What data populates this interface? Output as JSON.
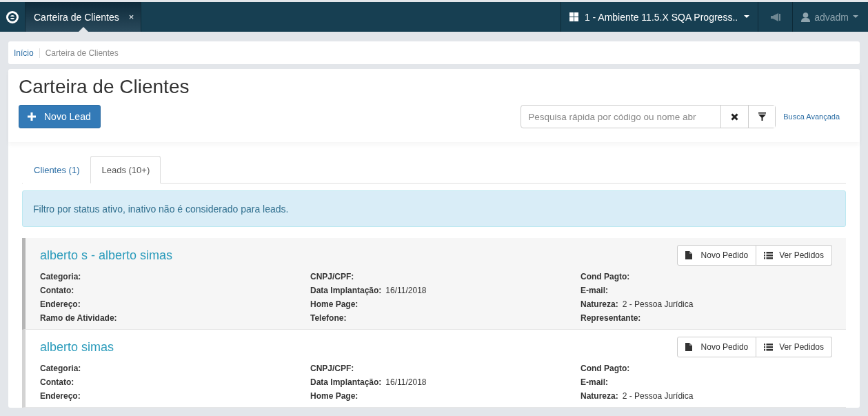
{
  "topbar": {
    "tab": {
      "label": "Carteira de Clientes",
      "close": "×",
      "selected": true
    },
    "environment": "1 - Ambiente 11.5.X SQA Progress..",
    "user": "advadm"
  },
  "breadcrumb": [
    {
      "label": "Início",
      "link": true
    },
    {
      "label": "Carteira de Clientes",
      "link": false
    }
  ],
  "page": {
    "title": "Carteira de Clientes",
    "new_button": "Novo Lead",
    "search": {
      "placeholder": "Pesquisa rápida por código ou nome abr"
    },
    "advanced_search": "Busca Avançada"
  },
  "tabs": [
    {
      "label": "Clientes (1)",
      "selected": false
    },
    {
      "label": "Leads (10+)",
      "selected": true
    }
  ],
  "alert": "Filtro por status ativo, inativo não é considerado para leads.",
  "leads": [
    {
      "name": "alberto s - alberto simas",
      "selected": true,
      "buttons": [
        "Novo Pedido",
        "Ver Pedidos"
      ],
      "fields": [
        {
          "label": "Categoria:"
        },
        {
          "label": "CNPJ/CPF:"
        },
        {
          "label": "Cond Pagto:"
        },
        {
          "label": "Contato:"
        },
        {
          "label": "Data Implantação:",
          "value": "16/11/2018"
        },
        {
          "label": "E-mail:"
        },
        {
          "label": "Endereço:"
        },
        {
          "label": "Home Page:"
        },
        {
          "label": "Natureza:",
          "value": "2 - Pessoa Jurídica"
        },
        {
          "label": "Ramo de Atividade:"
        },
        {
          "label": "Telefone:"
        },
        {
          "label": "Representante:"
        }
      ]
    },
    {
      "name": "alberto simas",
      "selected": false,
      "buttons": [
        "Novo Pedido",
        "Ver Pedidos"
      ],
      "fields": [
        {
          "label": "Categoria:"
        },
        {
          "label": "CNPJ/CPF:"
        },
        {
          "label": "Cond Pagto:"
        },
        {
          "label": "Contato:"
        },
        {
          "label": "Data Implantação:",
          "value": "16/11/2018"
        },
        {
          "label": "E-mail:"
        },
        {
          "label": "Endereço:"
        },
        {
          "label": "Home Page:"
        },
        {
          "label": "Natureza:",
          "value": "2 - Pessoa Jurídica"
        }
      ]
    }
  ]
}
